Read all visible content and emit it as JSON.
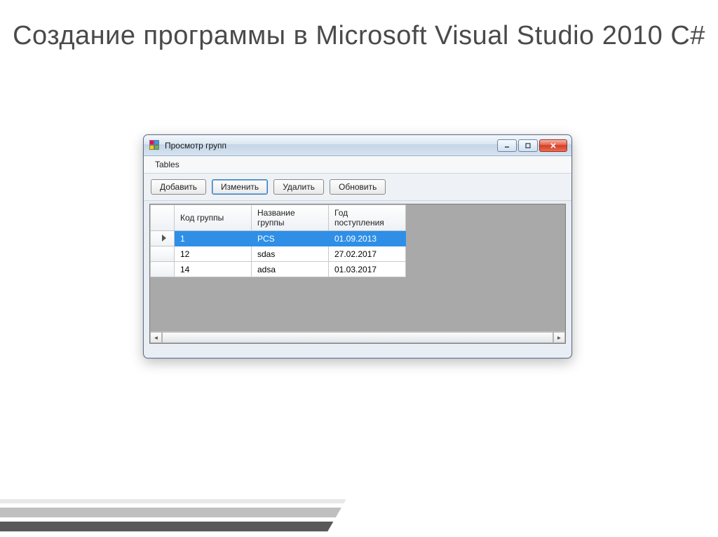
{
  "slide": {
    "title": "Создание программы в Microsoft Visual Studio 2010 C#"
  },
  "window": {
    "title": "Просмотр групп"
  },
  "menu": {
    "tables": "Tables"
  },
  "toolbar": {
    "add": "Добавить",
    "edit": "Изменить",
    "delete": "Удалить",
    "refresh": "Обновить"
  },
  "grid": {
    "headers": {
      "code": "Код группы",
      "name": "Название группы",
      "year": "Год поступления"
    },
    "rows": [
      {
        "code": "1",
        "name": "PCS",
        "year": "01.09.2013",
        "selected": true
      },
      {
        "code": "12",
        "name": "sdas",
        "year": "27.02.2017",
        "selected": false
      },
      {
        "code": "14",
        "name": "adsa",
        "year": "01.03.2017",
        "selected": false
      }
    ]
  }
}
